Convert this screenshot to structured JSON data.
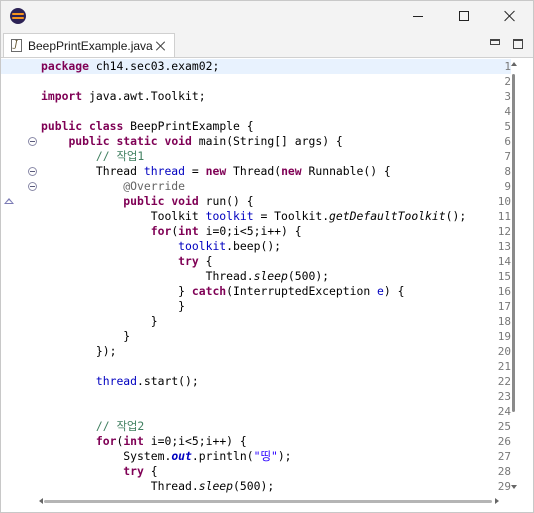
{
  "window": {
    "controls": [
      "minimize-icon",
      "maximize-icon",
      "close-icon"
    ]
  },
  "tab": {
    "label": "BeepPrintExample.java",
    "icon": "java-file-icon"
  },
  "editor": {
    "current_line": 1,
    "colors": {
      "keyword": "#7f0055",
      "field": "#0000c0",
      "comment": "#3f7f5f",
      "annotation": "#646464",
      "string": "#2a00ff",
      "current_line_bg": "#e8f2fe"
    },
    "folding_lines": [
      6,
      8,
      9
    ],
    "override_marker_line": 10,
    "lines": [
      {
        "n": "1",
        "tokens": [
          [
            "kw",
            "package"
          ],
          [
            "",
            "ch14.sec03.exam02;"
          ]
        ]
      },
      {
        "n": "2",
        "tokens": []
      },
      {
        "n": "3",
        "tokens": [
          [
            "kw",
            "import"
          ],
          [
            "",
            "java.awt.Toolkit;"
          ]
        ]
      },
      {
        "n": "4",
        "tokens": []
      },
      {
        "n": "5",
        "tokens": [
          [
            "kw",
            "public"
          ],
          [
            "",
            ""
          ],
          [
            "kw",
            "class"
          ],
          [
            "",
            "BeepPrintExample {"
          ]
        ]
      },
      {
        "n": "6",
        "tokens": [
          [
            "",
            "    "
          ],
          [
            "kw",
            "public"
          ],
          [
            "",
            ""
          ],
          [
            "kw",
            "static"
          ],
          [
            "",
            ""
          ],
          [
            "kw",
            "void"
          ],
          [
            "",
            "main(String[] args) {"
          ]
        ]
      },
      {
        "n": "7",
        "tokens": [
          [
            "",
            "        "
          ],
          [
            "cmt",
            "// 작업1"
          ]
        ]
      },
      {
        "n": "8",
        "tokens": [
          [
            "",
            "        Thread "
          ],
          [
            "fld",
            "thread"
          ],
          [
            "",
            "= "
          ],
          [
            "kw",
            "new"
          ],
          [
            "",
            "Thread("
          ],
          [
            "kw",
            "new"
          ],
          [
            "",
            "Runnable() {"
          ]
        ]
      },
      {
        "n": "9",
        "tokens": [
          [
            "",
            "            "
          ],
          [
            "ann",
            "@Override"
          ]
        ]
      },
      {
        "n": "10",
        "tokens": [
          [
            "",
            "            "
          ],
          [
            "kw",
            "public"
          ],
          [
            "",
            ""
          ],
          [
            "kw",
            "void"
          ],
          [
            "",
            "run() {"
          ]
        ]
      },
      {
        "n": "11",
        "tokens": [
          [
            "",
            "                Toolkit "
          ],
          [
            "fld",
            "toolkit"
          ],
          [
            "",
            "= Toolkit."
          ],
          [
            "smeth",
            "getDefaultToolkit"
          ],
          [
            "",
            "();"
          ]
        ]
      },
      {
        "n": "12",
        "tokens": [
          [
            "",
            "                "
          ],
          [
            "kw",
            "for"
          ],
          [
            "",
            "("
          ],
          [
            "kw",
            "int"
          ],
          [
            "",
            "i=0;i<5;i++) {"
          ]
        ]
      },
      {
        "n": "13",
        "tokens": [
          [
            "",
            "                    "
          ],
          [
            "fld",
            "toolkit"
          ],
          [
            "",
            ".beep();"
          ]
        ]
      },
      {
        "n": "14",
        "tokens": [
          [
            "",
            "                    "
          ],
          [
            "kw",
            "try"
          ],
          [
            "",
            "{"
          ]
        ]
      },
      {
        "n": "15",
        "tokens": [
          [
            "",
            "                        Thread."
          ],
          [
            "smeth",
            "sleep"
          ],
          [
            "",
            "(500);"
          ]
        ]
      },
      {
        "n": "16",
        "tokens": [
          [
            "",
            "                    } "
          ],
          [
            "kw",
            "catch"
          ],
          [
            "",
            "(InterruptedException "
          ],
          [
            "fld",
            "e"
          ],
          [
            "",
            ") {"
          ]
        ]
      },
      {
        "n": "17",
        "tokens": [
          [
            "",
            "                    }"
          ]
        ]
      },
      {
        "n": "18",
        "tokens": [
          [
            "",
            "                }"
          ]
        ]
      },
      {
        "n": "19",
        "tokens": [
          [
            "",
            "            }"
          ]
        ]
      },
      {
        "n": "20",
        "tokens": [
          [
            "",
            "        });"
          ]
        ]
      },
      {
        "n": "21",
        "tokens": []
      },
      {
        "n": "22",
        "tokens": [
          [
            "",
            "        "
          ],
          [
            "fld",
            "thread"
          ],
          [
            "",
            ".start();"
          ]
        ]
      },
      {
        "n": "23",
        "tokens": []
      },
      {
        "n": "24",
        "tokens": []
      },
      {
        "n": "25",
        "tokens": [
          [
            "",
            "        "
          ],
          [
            "cmt",
            "// 작업2"
          ]
        ]
      },
      {
        "n": "26",
        "tokens": [
          [
            "",
            "        "
          ],
          [
            "kw",
            "for"
          ],
          [
            "",
            "("
          ],
          [
            "kw",
            "int"
          ],
          [
            "",
            "i=0;i<5;i++) {"
          ]
        ]
      },
      {
        "n": "27",
        "tokens": [
          [
            "",
            "            System."
          ],
          [
            "sfld",
            "out"
          ],
          [
            "",
            ".println("
          ],
          [
            "str",
            "\"띵\""
          ],
          [
            "",
            ");"
          ]
        ]
      },
      {
        "n": "28",
        "tokens": [
          [
            "",
            "            "
          ],
          [
            "kw",
            "try"
          ],
          [
            "",
            "{"
          ]
        ]
      },
      {
        "n": "29",
        "tokens": [
          [
            "",
            "                Thread."
          ],
          [
            "smeth",
            "sleep"
          ],
          [
            "",
            "(500);"
          ]
        ]
      }
    ]
  }
}
